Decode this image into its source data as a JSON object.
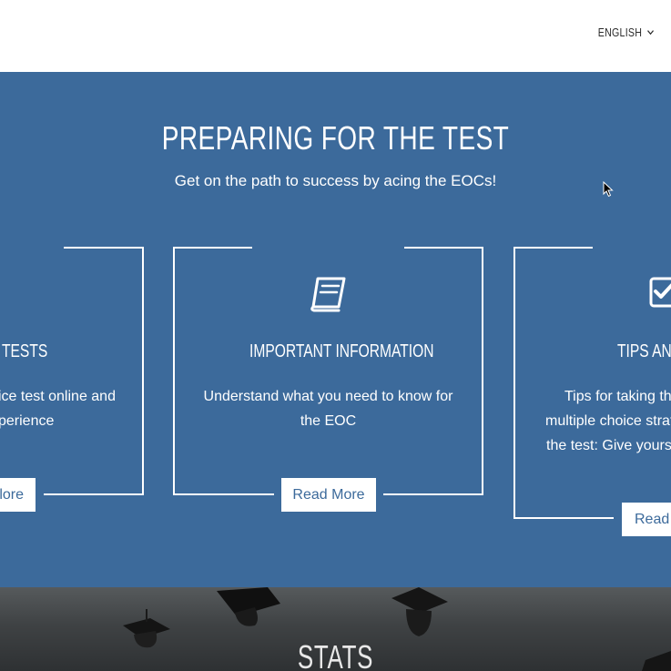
{
  "header": {
    "language_label": "ENGLISH"
  },
  "hero": {
    "title": "PREPARING FOR THE TEST",
    "subtitle": "Get on the path to success by acing the EOCs!"
  },
  "cards": [
    {
      "icon": "pencil-icon",
      "title": "TESTS",
      "text_lines": [
        "ice test online and",
        "perience"
      ],
      "button_label": "lore"
    },
    {
      "icon": "book-icon",
      "title": "IMPORTANT INFORMATION",
      "text_lines": [
        "Understand what you need to know for",
        "the EOC"
      ],
      "button_label": "Read More"
    },
    {
      "icon": "checkbox-icon",
      "title": "TIPS AND",
      "text_lines": [
        "Tips for taking the",
        "multiple choice strat",
        "the test: Give yourse"
      ],
      "button_label": "Read"
    }
  ],
  "stats": {
    "title": "STATS"
  },
  "colors": {
    "hero_bg": "#3c6a9b",
    "button_text": "#3c6a9b",
    "card_line": "#ffffff"
  }
}
